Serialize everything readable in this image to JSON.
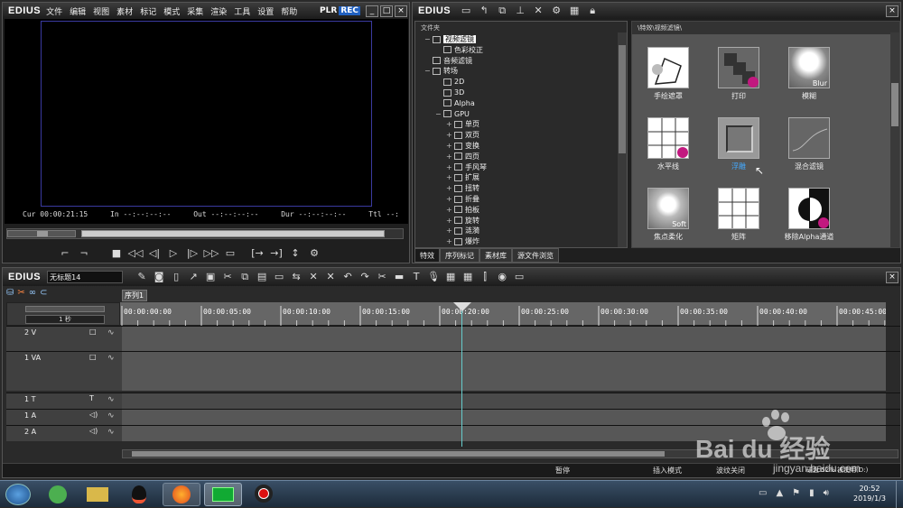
{
  "player": {
    "logo": "EDIUS",
    "menu": [
      "文件",
      "编辑",
      "视图",
      "素材",
      "标记",
      "模式",
      "采集",
      "渲染",
      "工具",
      "设置",
      "帮助"
    ],
    "plr": "PLR",
    "rec": "REC",
    "cur": "Cur 00:00:21:15",
    "in": "In --:--:--:--",
    "out": "Out --:--:--:--",
    "dur": "Dur --:--:--:--",
    "ttl": "Ttl --:"
  },
  "effects": {
    "logo": "EDIUS",
    "tree_header": "文件夹",
    "path": "\\特效\\视频滤镜\\",
    "tree": [
      {
        "label": "视频滤镜",
        "level": 1,
        "exp": "−",
        "selected": true
      },
      {
        "label": "色彩校正",
        "level": 2,
        "exp": ""
      },
      {
        "label": "音频滤镜",
        "level": 1,
        "exp": ""
      },
      {
        "label": "转场",
        "level": 1,
        "exp": "−"
      },
      {
        "label": "2D",
        "level": 2,
        "exp": ""
      },
      {
        "label": "3D",
        "level": 2,
        "exp": ""
      },
      {
        "label": "Alpha",
        "level": 2,
        "exp": ""
      },
      {
        "label": "GPU",
        "level": 2,
        "exp": "−"
      },
      {
        "label": "单页",
        "level": 3,
        "exp": "+"
      },
      {
        "label": "双页",
        "level": 3,
        "exp": "+"
      },
      {
        "label": "变换",
        "level": 3,
        "exp": "+"
      },
      {
        "label": "四页",
        "level": 3,
        "exp": "+"
      },
      {
        "label": "手风琴",
        "level": 3,
        "exp": "+"
      },
      {
        "label": "扩展",
        "level": 3,
        "exp": "+"
      },
      {
        "label": "扭转",
        "level": 3,
        "exp": "+"
      },
      {
        "label": "折叠",
        "level": 3,
        "exp": "+"
      },
      {
        "label": "拍板",
        "level": 3,
        "exp": "+"
      },
      {
        "label": "旋转",
        "level": 3,
        "exp": "+"
      },
      {
        "label": "涟漪",
        "level": 3,
        "exp": "+"
      },
      {
        "label": "爆炸",
        "level": 3,
        "exp": "+"
      }
    ],
    "items": [
      {
        "label": "手绘遮罩",
        "kind": "mask"
      },
      {
        "label": "打印",
        "kind": "print"
      },
      {
        "label": "模糊",
        "kind": "blur",
        "overlay": "Blur"
      },
      {
        "label": "水平线",
        "kind": "grid"
      },
      {
        "label": "浮雕",
        "kind": "emboss",
        "selected": true
      },
      {
        "label": "混合滤镜",
        "kind": "curve"
      },
      {
        "label": "焦点柔化",
        "kind": "soft",
        "overlay": "Soft"
      },
      {
        "label": "矩阵",
        "kind": "matrix"
      },
      {
        "label": "移除Alpha通道",
        "kind": "alpha"
      }
    ],
    "tabs": [
      "特效",
      "序列标记",
      "素材库",
      "源文件浏览"
    ]
  },
  "timeline": {
    "logo": "EDIUS",
    "project": "无标题14",
    "sequence_tab": "序列1",
    "scale": "1 秒",
    "ruler": [
      "00:00:00:00",
      "00:00:05:00",
      "00:00:10:00",
      "00:00:15:00",
      "00:00:20:00",
      "00:00:25:00",
      "00:00:30:00",
      "00:00:35:00",
      "00:00:40:00",
      "00:00:45:00"
    ],
    "tracks": [
      {
        "name": "2 V"
      },
      {
        "name": "1 VA"
      },
      {
        "name": "1 T"
      },
      {
        "name": "1 A"
      },
      {
        "name": "2 A"
      }
    ],
    "status": [
      "暂停",
      "插入模式",
      "波纹关闭",
      "硬盘:52% 被使用(D:)"
    ]
  },
  "taskbar": {
    "time": "20:52",
    "date": "2019/1/3"
  },
  "watermark": {
    "brand": "Bai du 经验",
    "url": "jingyan.baidu.com"
  }
}
